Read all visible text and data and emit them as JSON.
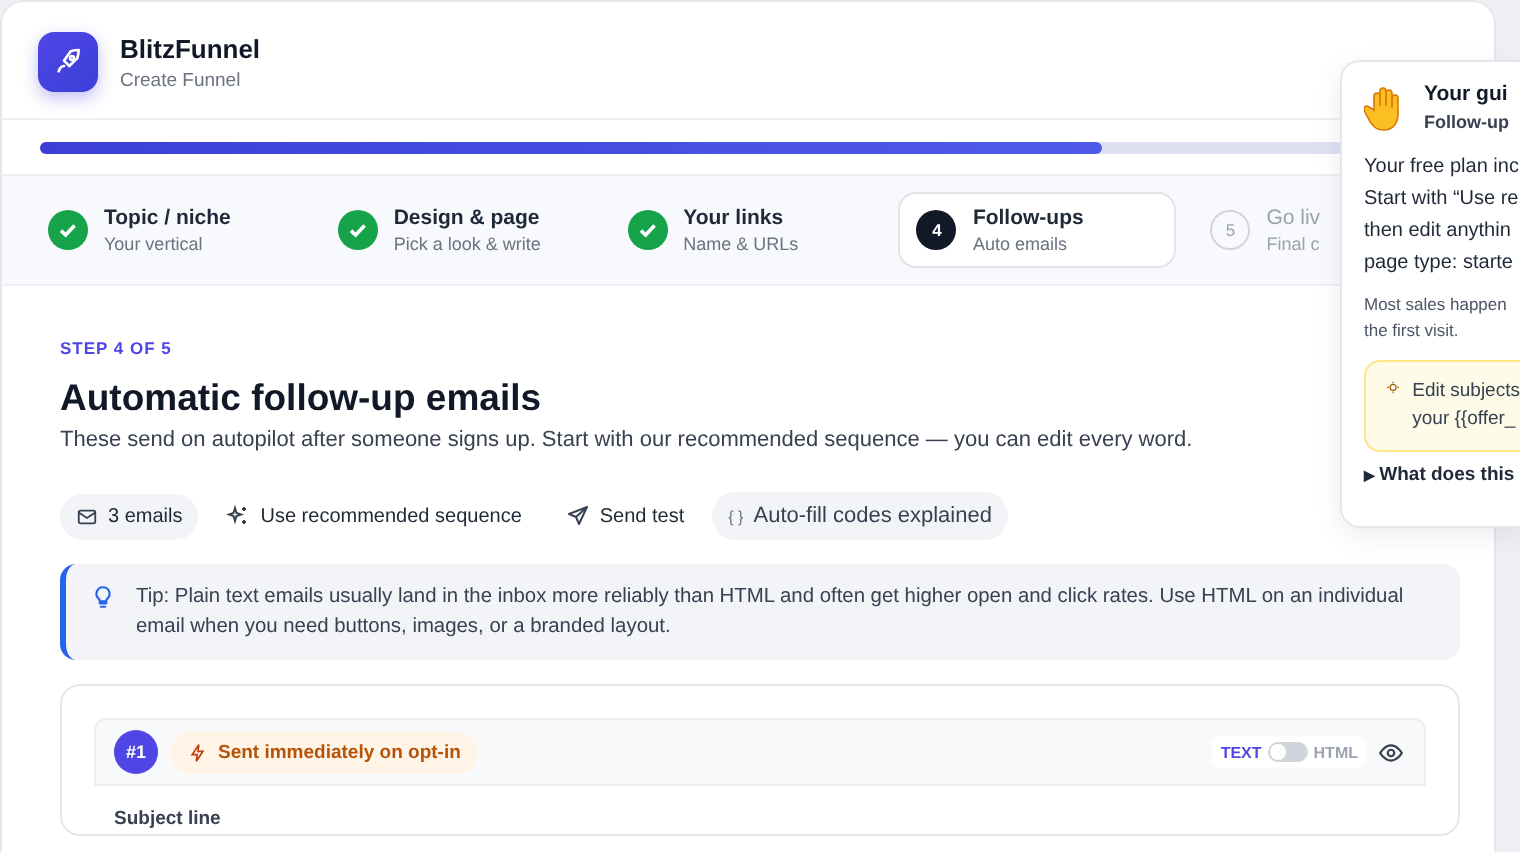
{
  "app": {
    "name": "BlitzFunnel",
    "subtitle": "Create Funnel"
  },
  "progress": {
    "level": 0.75
  },
  "steps": [
    {
      "done": true,
      "selected": false,
      "title": "Topic / niche",
      "subtitle": "Your vertical"
    },
    {
      "done": true,
      "selected": false,
      "title": "Design & page",
      "subtitle": "Pick a look & write"
    },
    {
      "done": true,
      "selected": false,
      "title": "Your links",
      "subtitle": "Name & URLs"
    },
    {
      "done": false,
      "selected": true,
      "number": "4",
      "title": "Follow-ups",
      "subtitle": "Auto emails"
    },
    {
      "done": false,
      "selected": false,
      "number": "5",
      "title": "Go liv",
      "subtitle": "Final c"
    }
  ],
  "content": {
    "eyebrow": "STEP 4 OF 5",
    "heading": "Automatic follow-up emails",
    "description": "These send on autopilot after someone signs up. Start with our recommended sequence — you can edit every word."
  },
  "toolbar": [
    {
      "kind": "count",
      "label": "3 emails"
    },
    {
      "kind": "sparkle",
      "label": "Use recommended sequence"
    },
    {
      "kind": "send",
      "label": "Send test"
    },
    {
      "kind": "codes",
      "icon": "{ }",
      "label": "Auto-fill codes explained"
    }
  ],
  "tip": {
    "text": "Tip: Plain text emails usually land in the inbox more reliably than HTML and often get higher open and click rates. Use HTML on an individual email when you need buttons, images, or a branded layout."
  },
  "emails": [
    {
      "badge": "#1",
      "timing": "Sent immediately on opt-in",
      "format_toggle": {
        "left_label": "TEXT",
        "right_label": "HTML",
        "on": false
      },
      "field_label": "Subject line"
    }
  ],
  "guide": {
    "title": "Your gui",
    "subtitle": "Follow-up",
    "lines": [
      "Your free plan inc",
      "Start with “Use re",
      "then edit anythin",
      "page type: starte"
    ],
    "note_lines": [
      "Most sales happen",
      "the first visit."
    ],
    "hint_lines": [
      "Edit subjects",
      "your {{offer_"
    ],
    "disclosure": {
      "marker": "▶",
      "label": "What does this"
    }
  }
}
